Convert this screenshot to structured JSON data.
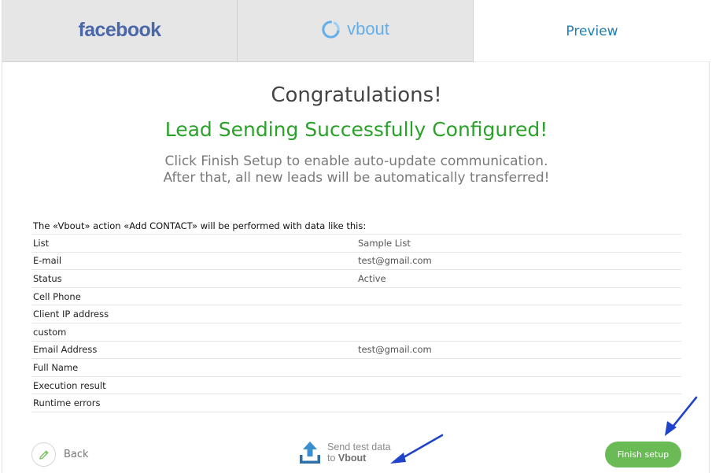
{
  "tabs": {
    "facebook": "facebook",
    "vbout": "vbout",
    "preview": "Preview"
  },
  "hero": {
    "title": "Congratulations!",
    "subtitle": "Lead Sending Successfully Configured!",
    "note_line1": "Click Finish Setup to enable auto-update communication.",
    "note_line2": "After that, all new leads will be automatically transferred!"
  },
  "table": {
    "caption": "The «Vbout» action «Add CONTACT» will be performed with data like this:",
    "rows": [
      {
        "key": "List",
        "value": "Sample List"
      },
      {
        "key": "E-mail",
        "value": "test@gmail.com"
      },
      {
        "key": "Status",
        "value": "Active"
      },
      {
        "key": "Cell Phone",
        "value": ""
      },
      {
        "key": "Client IP address",
        "value": ""
      },
      {
        "key": "custom",
        "value": ""
      },
      {
        "key": "Email Address",
        "value": "test@gmail.com"
      },
      {
        "key": "Full Name",
        "value": ""
      },
      {
        "key": "Execution result",
        "value": ""
      },
      {
        "key": "Runtime errors",
        "value": ""
      }
    ]
  },
  "footer": {
    "back_label": "Back",
    "send_test_line1": "Send test data",
    "send_test_prefix": "to",
    "send_test_target": "Vbout",
    "finish_label": "Finish setup"
  },
  "icons": {
    "back": "pencil-icon",
    "send_test": "upload-icon",
    "vbout_logo": "ring-icon"
  },
  "colors": {
    "finish_button": "#6abb56",
    "success_text": "#2aa22a",
    "preview_tab": "#1f7fb5",
    "facebook_brand": "#4a67a8",
    "vbout_brand": "#64aeea",
    "annotation_arrow": "#1f44c9"
  }
}
